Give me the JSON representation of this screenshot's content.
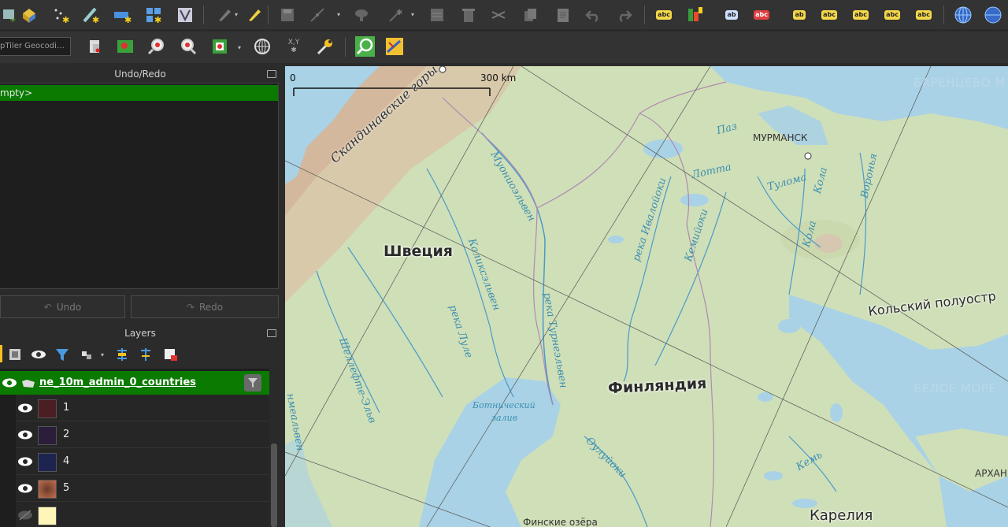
{
  "toolbar_secondary": {
    "geocoder_placeholder": "pTiler Geocodi…",
    "identify_label": "X,Y"
  },
  "undo_panel": {
    "title": "Undo/Redo",
    "empty_item": "mpty>",
    "undo_label": "Undo",
    "redo_label": "Redo"
  },
  "layers_panel": {
    "title": "Layers",
    "group_name": "ne_10m_admin_0_countries",
    "rows": [
      {
        "label": "1",
        "color": "#4a1e22"
      },
      {
        "label": "2",
        "color": "#2a1e3a"
      },
      {
        "label": "4",
        "color": "#1e2450"
      },
      {
        "label": "5",
        "color": "#9a5a3a"
      },
      {
        "label": "",
        "color": "#fff5b8"
      }
    ]
  },
  "map": {
    "scale_start": "0",
    "scale_end": "300 km",
    "labels": {
      "sweden": "Швеция",
      "finland": "Финляндия",
      "karelia": "Карелия",
      "kola": "Кольский полуостр",
      "murmansk": "МУРМАНСК",
      "barents": "БАРЕНЦЕВО М",
      "white_sea": "БЕЛОЕ МОРЕ",
      "arkh": "АРХАН",
      "bothnia1": "Ботнический",
      "bothnia2": "залив",
      "scand": "Скандинавские горы",
      "muonio": "Муониоэльвен",
      "kalix": "Каликсэльвен",
      "lule": "река Луле",
      "torne": "река Турнеэльвен",
      "skelleft": "Шеллефте-Эльв",
      "umea": "нмеальвен",
      "ivalo": "река Ивалойоки",
      "kemijoki": "Кемийоки",
      "lotta": "Лотта",
      "paz": "Паз",
      "tuloma": "Тулома",
      "kola_r1": "Кола",
      "kola_r2": "Кола",
      "voronya": "Воронья",
      "oulujoki": "Оулуйоки",
      "kem": "Кемь",
      "lakes": "Финские озёра"
    }
  }
}
